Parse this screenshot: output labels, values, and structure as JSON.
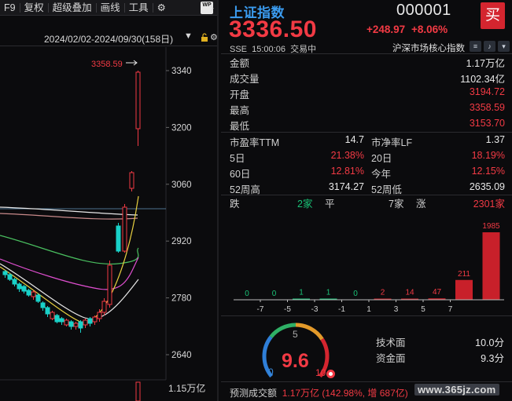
{
  "toolbar": {
    "f9": "F9",
    "restore_rights": "复权",
    "overlay": "超级叠加",
    "draw": "画线",
    "tools": "工具",
    "logo_text": "WP"
  },
  "chart": {
    "date_range": "2024/02/02-2024/09/30(158日)",
    "high_label": "3358.59",
    "y_ticks": [
      "3340",
      "3200",
      "3060",
      "2920",
      "2780",
      "2640"
    ],
    "volume_label": "1.15万亿",
    "colors": {
      "up": "#f23a44",
      "down": "#19d1c8"
    }
  },
  "quote": {
    "name": "上证指数",
    "code": "000001",
    "buy_label": "买",
    "price": "3336.50",
    "change": "+248.97",
    "change_pct": "+8.06%",
    "exchange": "SSE",
    "time": "15:00:06",
    "status": "交易中",
    "board": "沪深市场核心指数"
  },
  "stats": [
    {
      "label": "金额",
      "value": "1.17万亿",
      "red": false
    },
    {
      "label": "成交量",
      "value": "1102.34亿",
      "red": false
    },
    {
      "label": "开盘",
      "value": "3194.72",
      "red": true
    },
    {
      "label": "最高",
      "value": "3358.59",
      "red": true
    },
    {
      "label": "最低",
      "value": "3153.70",
      "red": true
    }
  ],
  "metrics": [
    {
      "l1": "市盈率TTM",
      "v1": "14.7",
      "c1": "",
      "l2": "市净率LF",
      "v2": "1.37",
      "c2": ""
    },
    {
      "l1": "5日",
      "v1": "21.38%",
      "c1": "red",
      "l2": "20日",
      "v2": "18.19%",
      "c2": "red"
    },
    {
      "l1": "60日",
      "v1": "12.81%",
      "c1": "red",
      "l2": "今年",
      "v2": "12.15%",
      "c2": "red"
    },
    {
      "l1": "52周高",
      "v1": "3174.27",
      "c1": "",
      "l2": "52周低",
      "v2": "2635.09",
      "c2": ""
    }
  ],
  "distribution": {
    "fall_label": "跌",
    "fall_count": "2家",
    "flat_label": "平",
    "flat_count": "7家",
    "rise_label": "涨",
    "rise_count": "2301家",
    "bins": [
      "-7",
      "-5",
      "-3",
      "-1",
      "1",
      "3",
      "5",
      "7"
    ],
    "counts": [
      0,
      0,
      1,
      1,
      0,
      2,
      14,
      47,
      211,
      1985
    ]
  },
  "gauge": {
    "value": "9.6",
    "min": "0",
    "mid": "5",
    "max": "10",
    "level": 0.96
  },
  "scores": [
    {
      "label": "技术面",
      "value": "10.0分"
    },
    {
      "label": "资金面",
      "value": "9.3分"
    }
  ],
  "forecast": {
    "label": "预测成交额",
    "value": "1.17万亿 (142.98%, 增 687亿)"
  },
  "watermark": "www.365jz.com"
}
